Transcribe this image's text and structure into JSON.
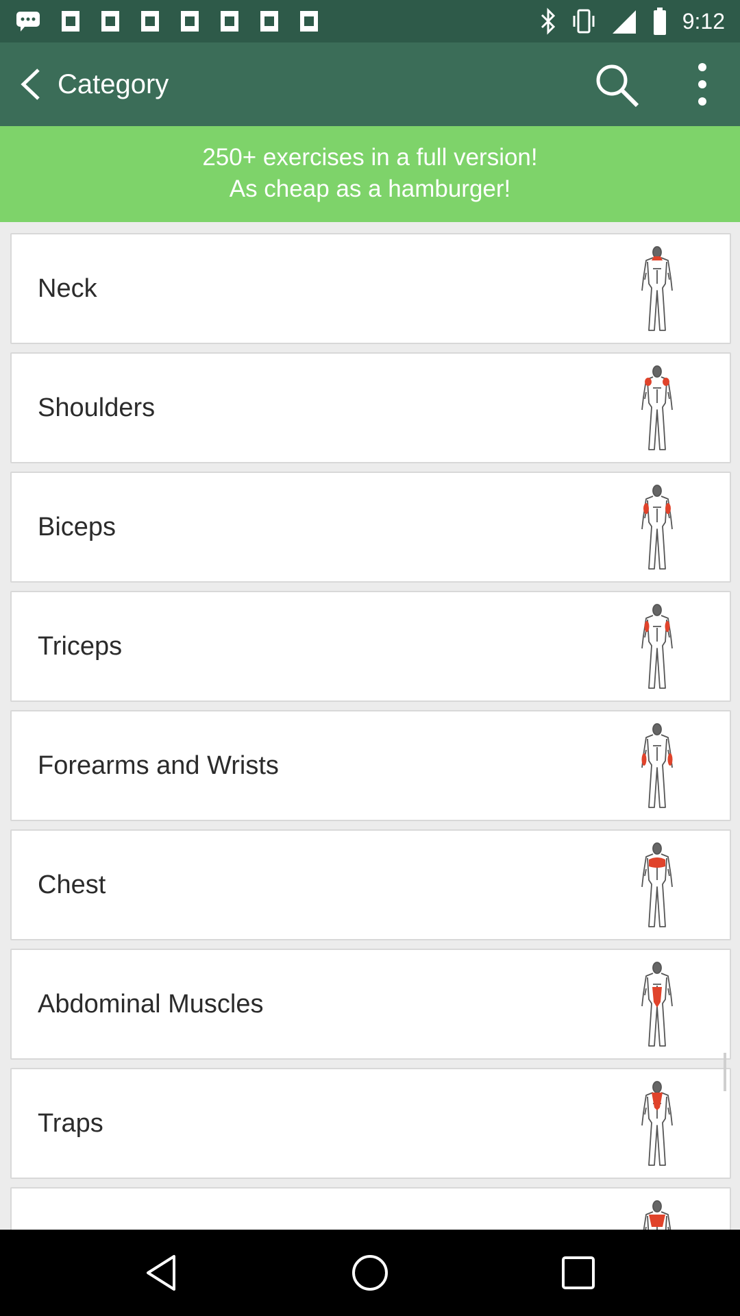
{
  "status_bar": {
    "time": "9:12",
    "left_icons": [
      "chat-icon",
      "image-icon",
      "image-icon",
      "image-icon",
      "image-icon",
      "image-icon",
      "image-icon",
      "image-icon"
    ],
    "right_icons": [
      "bluetooth-icon",
      "vibrate-icon",
      "signal-icon",
      "battery-icon"
    ]
  },
  "app_bar": {
    "title": "Category",
    "back_icon": "chevron-left-icon",
    "search_icon": "search-icon",
    "menu_icon": "more-vert-icon"
  },
  "promo": {
    "line1": "250+ exercises in a full version!",
    "line2": "As cheap as a hamburger!"
  },
  "categories": [
    {
      "label": "Neck",
      "highlight": "neck"
    },
    {
      "label": "Shoulders",
      "highlight": "shoulders"
    },
    {
      "label": "Biceps",
      "highlight": "biceps"
    },
    {
      "label": "Triceps",
      "highlight": "triceps"
    },
    {
      "label": "Forearms and Wrists",
      "highlight": "forearms"
    },
    {
      "label": "Chest",
      "highlight": "chest"
    },
    {
      "label": "Abdominal Muscles",
      "highlight": "abs"
    },
    {
      "label": "Traps",
      "highlight": "traps"
    },
    {
      "label": "",
      "highlight": "back"
    }
  ],
  "colors": {
    "status_bar": "#2e5a49",
    "app_bar": "#3b6d58",
    "promo": "#7ed36a",
    "highlight": "#e0432b"
  },
  "nav_bar": {
    "back_icon": "nav-back-icon",
    "home_icon": "nav-home-icon",
    "recents_icon": "nav-recents-icon"
  }
}
